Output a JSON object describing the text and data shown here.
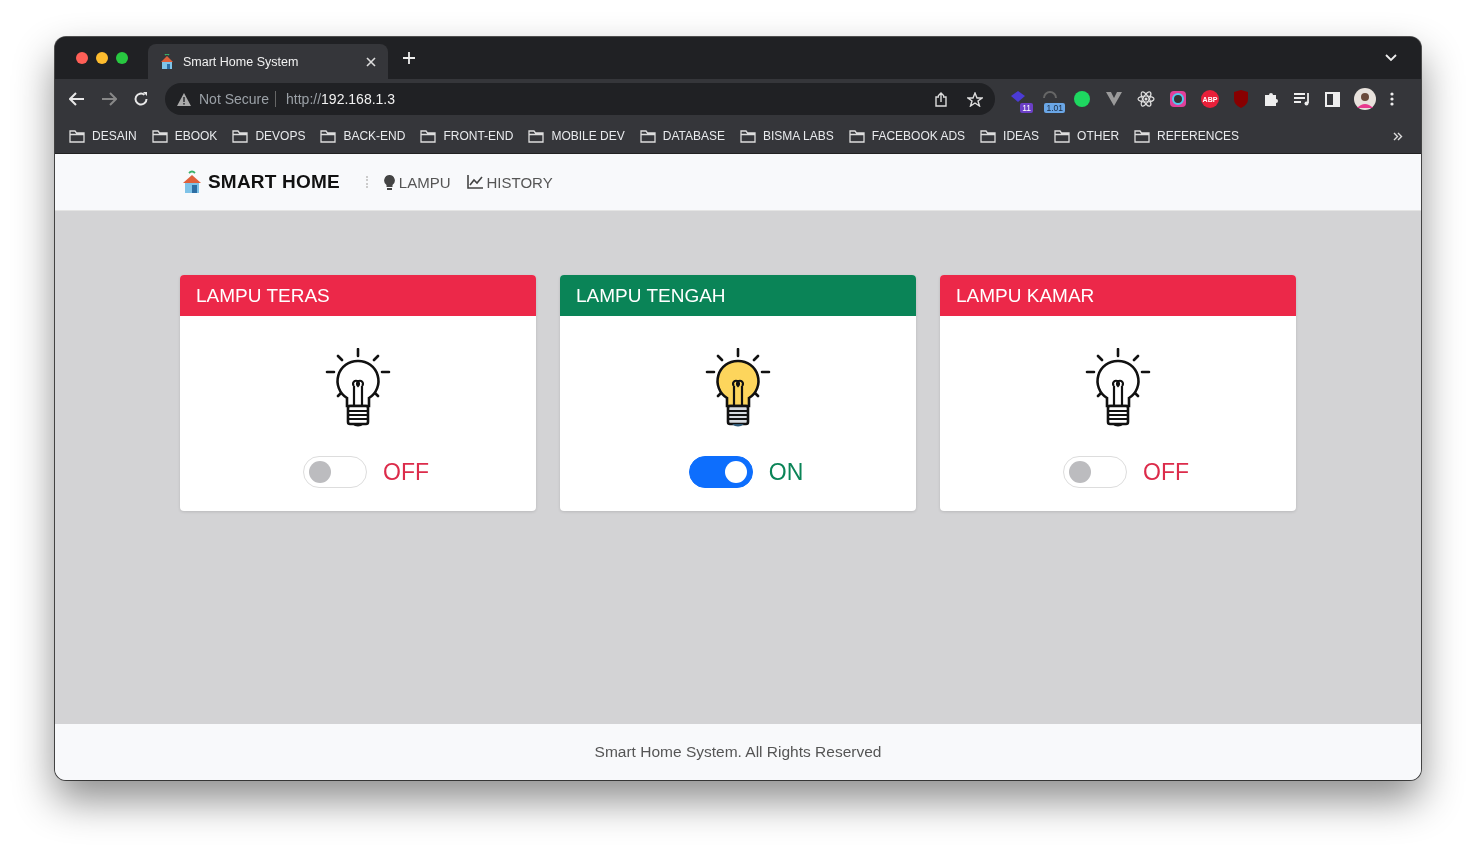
{
  "browser": {
    "tab": {
      "title": "Smart Home System"
    },
    "address": {
      "security": "Not Secure",
      "scheme": "http://",
      "host": "192.168.1.3"
    },
    "extensions": [
      {
        "kind": "purple",
        "badge": "11"
      },
      {
        "kind": "gray",
        "badge": "1.01"
      },
      {
        "kind": "green"
      },
      {
        "kind": "vee"
      },
      {
        "kind": "atom"
      },
      {
        "kind": "ring"
      },
      {
        "kind": "abp",
        "label": "ABP"
      },
      {
        "kind": "shield"
      }
    ],
    "bookmarks": [
      "DESAIN",
      "EBOOK",
      "DEVOPS",
      "BACK-END",
      "FRONT-END",
      "MOBILE DEV",
      "DATABASE",
      "BISMA LABS",
      "FACEBOOK ADS",
      "IDEAS",
      "OTHER",
      "REFERENCES"
    ]
  },
  "navbar": {
    "brand": "SMART HOME",
    "links": [
      {
        "kind": "bulb",
        "label": "LAMPU"
      },
      {
        "kind": "chart",
        "label": "HISTORY"
      }
    ]
  },
  "lamps": [
    {
      "name": "LAMPU TERAS",
      "on": false,
      "status": "OFF"
    },
    {
      "name": "LAMPU TENGAH",
      "on": true,
      "status": "ON"
    },
    {
      "name": "LAMPU KAMAR",
      "on": false,
      "status": "OFF"
    }
  ],
  "footer": "Smart Home System. All Rights Reserved"
}
